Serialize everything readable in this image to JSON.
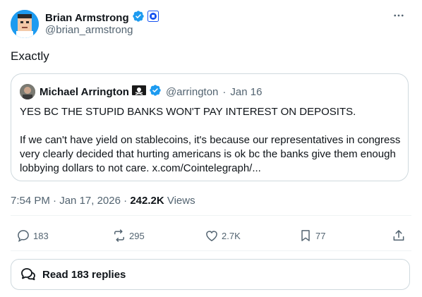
{
  "tweet": {
    "author_name": "Brian Armstrong",
    "author_handle": "@brian_armstrong",
    "text": "Exactly",
    "time": "7:54 PM",
    "date": "Jan 17, 2026",
    "views_count": "242.2K",
    "views_label": "Views"
  },
  "quote": {
    "author_name": "Michael Arrington",
    "author_handle": "@arrington",
    "date": "Jan 16",
    "line1": "YES BC THE STUPID BANKS WON'T PAY INTEREST ON DEPOSITS.",
    "line2": "If we can't have yield on stablecoins, it's because our representatives in congress very clearly decided that hurting americans is ok bc the banks give them enough lobbying dollars to not care. x.com/Cointelegraph/..."
  },
  "actions": {
    "replies": "183",
    "reposts": "295",
    "likes": "2.7K",
    "bookmarks": "77"
  },
  "read_replies_label": "Read 183 replies",
  "colors": {
    "verified": "#1d9bf0",
    "secondary_text": "#536471",
    "border": "#cfd9de"
  }
}
